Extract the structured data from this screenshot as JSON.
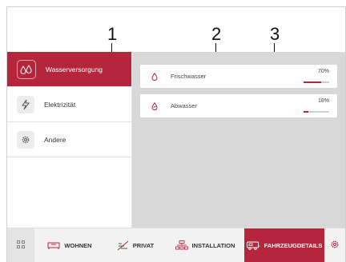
{
  "callouts": [
    "1",
    "2",
    "3"
  ],
  "sidebar": {
    "items": [
      {
        "label": "Wasserversorgung",
        "icon": "water-supply-icon",
        "active": true
      },
      {
        "label": "Elektrizität",
        "icon": "lightning-icon",
        "active": false
      },
      {
        "label": "Andere",
        "icon": "gear-icon",
        "active": false
      }
    ]
  },
  "main": {
    "cards": [
      {
        "label": "Frischwasser",
        "percent_text": "70%",
        "level": 0.7,
        "icon": "water-drop-icon"
      },
      {
        "label": "Abwasser",
        "percent_text": "18%",
        "level": 0.18,
        "icon": "waste-water-drop-icon"
      }
    ]
  },
  "bottom_nav": {
    "grid_icon": "app-grid-icon",
    "items": [
      {
        "label": "WOHNEN",
        "icon": "sofa-icon",
        "active": false
      },
      {
        "label": "PRIVAT",
        "icon": "privacy-icon",
        "active": false
      },
      {
        "label": "INSTALLATION",
        "icon": "installation-icon",
        "active": false
      },
      {
        "label": "FAHRZEUGDETAILS",
        "icon": "camper-icon",
        "active": true
      }
    ],
    "settings_icon": "gear-icon"
  },
  "colors": {
    "accent": "#b5253b",
    "panel": "#d8d8d8"
  }
}
